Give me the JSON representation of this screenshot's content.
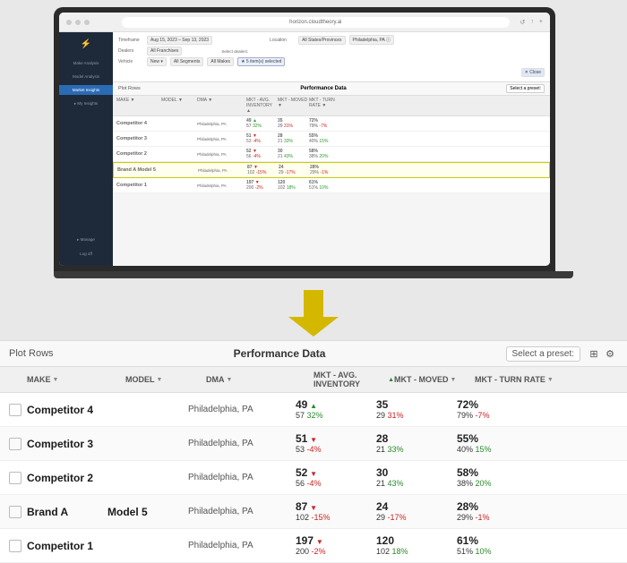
{
  "browser": {
    "url": "horizon.cloudtheory.ai"
  },
  "sidebar": {
    "logo": "⚡",
    "items": [
      {
        "label": "Make Analysis",
        "active": false
      },
      {
        "label": "Model Analysis",
        "active": false
      },
      {
        "label": "Market Insights",
        "active": true
      },
      {
        "label": "My Insights",
        "active": false
      },
      {
        "label": "Manage",
        "active": false
      },
      {
        "label": "Log off",
        "active": false
      }
    ]
  },
  "filters": {
    "timeframe_label": "Timeframe",
    "timeframe_val": "Aug 15, 2023 – Sep 13, 2023",
    "location_label": "Location",
    "location_val": "All States/Provinces",
    "location_val2": "Philadelphia, PA",
    "dealers_label": "Dealers",
    "dealers_val": "All Franchises",
    "dealers_val2": "Select dealers:",
    "vehicle_label": "Vehicle",
    "vehicle_val": "New",
    "vehicle_val2": "All Segments",
    "vehicle_val3": "All Makes",
    "vehicle_val4": "5 item(s) selected"
  },
  "tableHeader": {
    "plot_rows": "Plot Rows",
    "perf_data": "Performance Data",
    "select_preset": "Select a preset:"
  },
  "columns": {
    "make": "MAKE",
    "model": "MODEL",
    "dma": "DMA",
    "inv": "MKT - AVG. INVENTORY",
    "moved": "MKT - MOVED",
    "turn": "MKT - TURN RATE"
  },
  "rows": [
    {
      "make": "Competitor 4",
      "model": "",
      "dma": "Philadelphia, PA",
      "inv_main": "49",
      "inv_sub": "57",
      "inv_sub_dir": "up",
      "inv_sub_pct": "32%",
      "moved_main": "35",
      "moved_sub": "29",
      "moved_sub_dir": "down",
      "moved_sub_pct": "31%",
      "turn_main": "72%",
      "turn_sub": "79%",
      "turn_sub_dir": "down",
      "turn_sub_pct": "-7%"
    },
    {
      "make": "Competitor 3",
      "model": "",
      "dma": "Philadelphia, PA",
      "inv_main": "51",
      "inv_sub": "53",
      "inv_sub_dir": "down",
      "inv_sub_pct": "-4%",
      "moved_main": "28",
      "moved_sub": "21",
      "moved_sub_dir": "up",
      "moved_sub_pct": "33%",
      "turn_main": "55%",
      "turn_sub": "40%",
      "turn_sub_dir": "up",
      "turn_sub_pct": "15%"
    },
    {
      "make": "Competitor 2",
      "model": "",
      "dma": "Philadelphia, PA",
      "inv_main": "52",
      "inv_sub": "56",
      "inv_sub_dir": "down",
      "inv_sub_pct": "-4%",
      "moved_main": "30",
      "moved_sub": "21",
      "moved_sub_dir": "up",
      "moved_sub_pct": "43%",
      "turn_main": "58%",
      "turn_sub": "38%",
      "turn_sub_dir": "up",
      "turn_sub_pct": "20%"
    },
    {
      "make": "Brand A",
      "model": "Model 5",
      "dma": "Philadelphia, PA",
      "inv_main": "87",
      "inv_sub": "102",
      "inv_sub_dir": "down",
      "inv_sub_pct": "-15%",
      "moved_main": "24",
      "moved_sub": "29",
      "moved_sub_dir": "down",
      "moved_sub_pct": "-17%",
      "turn_main": "28%",
      "turn_sub": "29%",
      "turn_sub_dir": "down",
      "turn_sub_pct": "-1%"
    },
    {
      "make": "Competitor 1",
      "model": "",
      "dma": "Philadelphia, PA",
      "inv_main": "197",
      "inv_sub": "200",
      "inv_sub_dir": "down",
      "inv_sub_pct": "-2%",
      "moved_main": "120",
      "moved_sub": "102",
      "moved_sub_dir": "up",
      "moved_sub_pct": "18%",
      "turn_main": "61%",
      "turn_sub": "51%",
      "turn_sub_dir": "up",
      "turn_sub_pct": "10%"
    }
  ],
  "bottom_table": {
    "plot_rows": "Plot Rows",
    "perf_data": "Performance Data",
    "select_preset": "Select a preset:"
  }
}
